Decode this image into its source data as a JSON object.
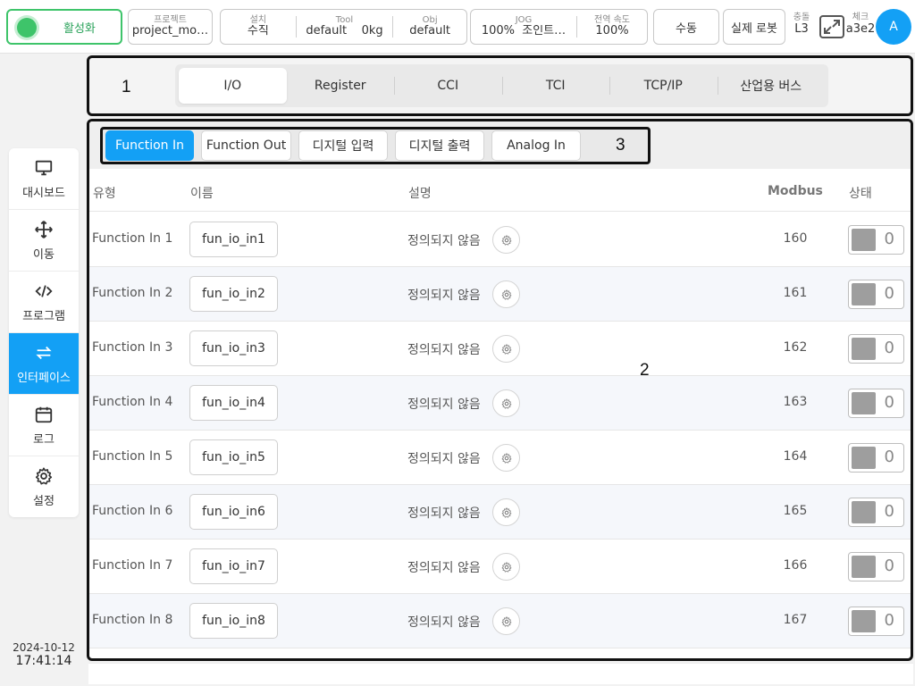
{
  "topbar": {
    "activate_label": "활성화",
    "project": {
      "label": "프로젝트",
      "value": "project_mo…"
    },
    "install": {
      "label": "설치",
      "value": "수직"
    },
    "tool": {
      "label": "Tool",
      "value": "default",
      "weight": "0kg"
    },
    "obj": {
      "label": "Obj",
      "value": "default"
    },
    "jog": {
      "label": "JOG",
      "percent": "100%",
      "mode": "조인트…"
    },
    "global_speed": {
      "label": "전역 속도",
      "value": "100%"
    },
    "manual_label": "수동",
    "real_robot_label": "실제 로봇",
    "collision": {
      "label": "충돌",
      "value": "L3"
    },
    "check": {
      "label": "체크",
      "value": "a3e2"
    },
    "avatar_letter": "A",
    "accent": "#13a0f5",
    "active_green": "#3ec46a"
  },
  "sidebar": {
    "items": [
      {
        "label": "대시보드",
        "icon": "monitor-icon"
      },
      {
        "label": "이동",
        "icon": "move-arrows-icon"
      },
      {
        "label": "프로그램",
        "icon": "code-icon"
      },
      {
        "label": "인터페이스",
        "icon": "swap-arrows-icon",
        "active": true
      },
      {
        "label": "로그",
        "icon": "calendar-icon"
      },
      {
        "label": "설정",
        "icon": "gear-icon"
      }
    ],
    "date": "2024-10-12",
    "time": "17:41:14"
  },
  "annotations": {
    "a1": "1",
    "a2": "2",
    "a3": "3"
  },
  "main_tabs": [
    "I/O",
    "Register",
    "CCI",
    "TCI",
    "TCP/IP",
    "산업용 버스"
  ],
  "active_main_tab": "I/O",
  "sub_tabs": [
    "Function In",
    "Function Out",
    "디지털 입력",
    "디지털 출력",
    "Analog In"
  ],
  "active_sub_tab": "Function In",
  "table": {
    "headers": {
      "type": "유형",
      "name": "이름",
      "desc": "설명",
      "modbus": "Modbus",
      "state": "상태"
    },
    "rows": [
      {
        "type": "Function In 1",
        "name": "fun_io_in1",
        "desc": "정의되지 않음",
        "modbus": "160",
        "state": "0"
      },
      {
        "type": "Function In 2",
        "name": "fun_io_in2",
        "desc": "정의되지 않음",
        "modbus": "161",
        "state": "0"
      },
      {
        "type": "Function In 3",
        "name": "fun_io_in3",
        "desc": "정의되지 않음",
        "modbus": "162",
        "state": "0"
      },
      {
        "type": "Function In 4",
        "name": "fun_io_in4",
        "desc": "정의되지 않음",
        "modbus": "163",
        "state": "0"
      },
      {
        "type": "Function In 5",
        "name": "fun_io_in5",
        "desc": "정의되지 않음",
        "modbus": "164",
        "state": "0"
      },
      {
        "type": "Function In 6",
        "name": "fun_io_in6",
        "desc": "정의되지 않음",
        "modbus": "165",
        "state": "0"
      },
      {
        "type": "Function In 7",
        "name": "fun_io_in7",
        "desc": "정의되지 않음",
        "modbus": "166",
        "state": "0"
      },
      {
        "type": "Function In 8",
        "name": "fun_io_in8",
        "desc": "정의되지 않음",
        "modbus": "167",
        "state": "0"
      }
    ]
  }
}
